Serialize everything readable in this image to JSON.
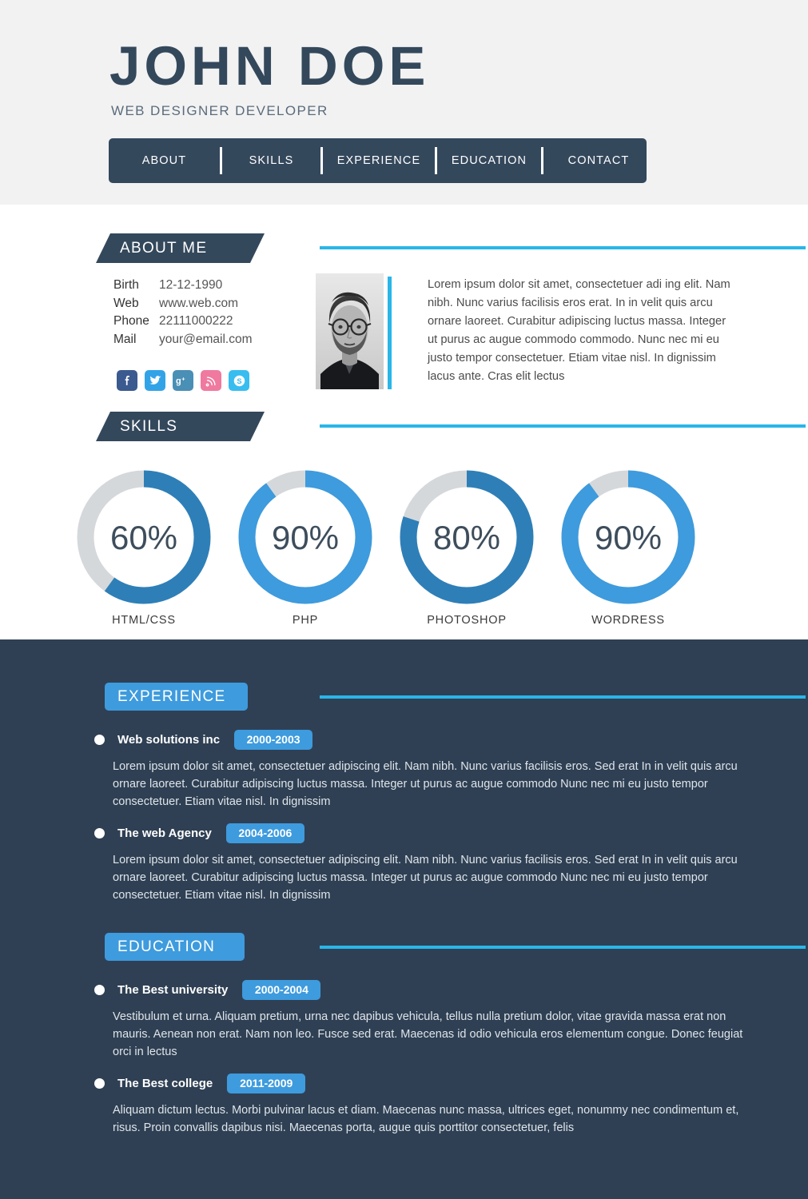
{
  "header": {
    "name": "JOHN DOE",
    "subtitle": "WEB DESIGNER DEVELOPER",
    "nav": [
      {
        "label": "ABOUT"
      },
      {
        "label": "SKILLS"
      },
      {
        "label": "EXPERIENCE"
      },
      {
        "label": "EDUCATION"
      },
      {
        "label": "CONTACT"
      }
    ]
  },
  "about": {
    "heading": "ABOUT ME",
    "info": [
      {
        "label": "Birth",
        "value": "12-12-1990"
      },
      {
        "label": "Web",
        "value": "www.web.com"
      },
      {
        "label": "Phone",
        "value": "22111000222"
      },
      {
        "label": "Mail",
        "value": "your@email.com"
      }
    ],
    "social": [
      {
        "name": "facebook-icon",
        "color": "#3b5a8f"
      },
      {
        "name": "twitter-icon",
        "color": "#33a3e8"
      },
      {
        "name": "google-plus-icon",
        "color": "#4a8fb5"
      },
      {
        "name": "rss-icon",
        "color": "#f0799f"
      },
      {
        "name": "skype-icon",
        "color": "#38bdf0"
      }
    ],
    "bio": "Lorem ipsum dolor sit amet, consectetuer adi ing elit. Nam nibh. Nunc varius facilisis eros erat. In in velit quis arcu ornare laoreet. Curabitur adipiscing luctus massa. Integer ut purus ac augue commodo commodo. Nunc nec mi eu justo tempor consectetuer. Etiam vitae nisl. In dignissim lacus ante. Cras elit lectus"
  },
  "skills": {
    "heading": "SKILLS"
  },
  "chart_data": {
    "type": "pie",
    "title": "SKILLS",
    "subtype": "donut-gauge",
    "categories": [
      "HTML/CSS",
      "PHP",
      "PHOTOSHOP",
      "WORDRESS"
    ],
    "values": [
      60,
      90,
      80,
      90
    ],
    "value_labels": [
      "60%",
      "90%",
      "80%",
      "90%"
    ],
    "unit": "percent",
    "ylim": [
      0,
      100
    ],
    "colors": [
      "#2e7fb8",
      "#3e9bdd",
      "#2e7fb8",
      "#3e9bdd"
    ],
    "track_color": "#d5d8db",
    "legend": "below-each",
    "grid": false
  },
  "experience": {
    "heading": "EXPERIENCE",
    "entries": [
      {
        "org": "Web solutions inc",
        "date": "2000-2003",
        "body": "Lorem ipsum dolor sit amet, consectetuer adipiscing elit. Nam nibh. Nunc varius facilisis eros. Sed erat In in velit quis arcu ornare laoreet. Curabitur adipiscing luctus massa. Integer ut purus ac augue commodo Nunc nec mi eu justo tempor consectetuer. Etiam vitae nisl. In dignissim"
      },
      {
        "org": "The web Agency",
        "date": "2004-2006",
        "body": "Lorem ipsum dolor sit amet, consectetuer adipiscing elit. Nam nibh. Nunc varius facilisis eros. Sed erat In in velit quis arcu ornare laoreet. Curabitur adipiscing luctus massa. Integer ut purus ac augue commodo Nunc nec mi eu justo tempor consectetuer. Etiam vitae nisl. In dignissim"
      }
    ]
  },
  "education": {
    "heading": "EDUCATION",
    "entries": [
      {
        "org": "The Best university",
        "date": "2000-2004",
        "body": "Vestibulum et urna. Aliquam pretium, urna nec dapibus vehicula, tellus nulla pretium dolor, vitae gravida massa erat non mauris. Aenean non erat. Nam non leo. Fusce sed erat. Maecenas id odio vehicula eros elementum congue. Donec feugiat orci in lectus"
      },
      {
        "org": "The Best college",
        "date": "2011-2009",
        "body": "Aliquam dictum lectus. Morbi pulvinar lacus et diam. Maecenas nunc massa, ultrices eget, nonummy nec condimentum et, risus. Proin convallis dapibus nisi. Maecenas porta, augue quis porttitor consectetuer, felis"
      }
    ]
  },
  "theme": {
    "dark_navy": "#34485c",
    "section_navy": "#2f4054",
    "accent_blue": "#3e9bdd",
    "accent_cyan": "#29b6e8",
    "deep_blue": "#2e7fb8",
    "track_gray": "#d5d8db",
    "header_bg": "#f2f2f2"
  }
}
